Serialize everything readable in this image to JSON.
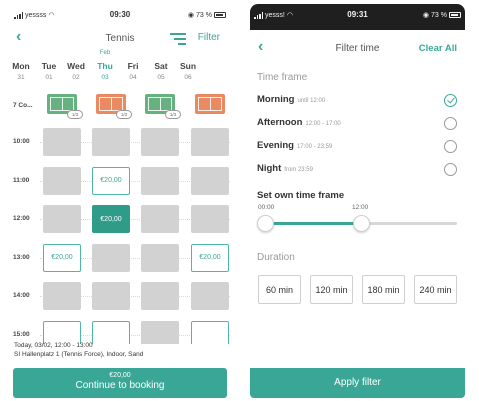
{
  "left": {
    "status": {
      "carrier": "yessss",
      "time": "09:30",
      "battery": "73 %"
    },
    "header": {
      "back_glyph": "‹",
      "title": "Tennis",
      "filter_icon": "filter-lines-icon",
      "filter_label": "Filter"
    },
    "month_label": "Feb",
    "days": [
      {
        "name": "Mon",
        "date": "31"
      },
      {
        "name": "Tue",
        "date": "01"
      },
      {
        "name": "Wed",
        "date": "02"
      },
      {
        "name": "Thu",
        "date": "03"
      },
      {
        "name": "Fri",
        "date": "04"
      },
      {
        "name": "Sat",
        "date": "05"
      },
      {
        "name": "Sun",
        "date": "06"
      }
    ],
    "court_row_label": "7 Co...",
    "courts": [
      {
        "color": "green",
        "badge": "1/3"
      },
      {
        "color": "orange",
        "badge": "1/3"
      },
      {
        "color": "green",
        "badge": "1/3"
      },
      {
        "color": "orange",
        "badge": ""
      }
    ],
    "times": [
      "10:00",
      "11:00",
      "12:00",
      "13:00",
      "14:00",
      "15:00"
    ],
    "slots": [
      [
        {
          "state": "unavailable",
          "price": ""
        },
        {
          "state": "unavailable",
          "price": ""
        },
        {
          "state": "unavailable",
          "price": ""
        },
        {
          "state": "unavailable",
          "price": ""
        }
      ],
      [
        {
          "state": "unavailable",
          "price": ""
        },
        {
          "state": "available",
          "price": "€20,00"
        },
        {
          "state": "unavailable",
          "price": ""
        },
        {
          "state": "unavailable",
          "price": ""
        }
      ],
      [
        {
          "state": "unavailable",
          "price": ""
        },
        {
          "state": "selected",
          "price": "€20,00"
        },
        {
          "state": "unavailable",
          "price": ""
        },
        {
          "state": "unavailable",
          "price": ""
        }
      ],
      [
        {
          "state": "available",
          "price": "€20,00"
        },
        {
          "state": "unavailable",
          "price": ""
        },
        {
          "state": "unavailable",
          "price": ""
        },
        {
          "state": "available",
          "price": "€20,00"
        }
      ],
      [
        {
          "state": "unavailable",
          "price": ""
        },
        {
          "state": "unavailable",
          "price": ""
        },
        {
          "state": "unavailable",
          "price": ""
        },
        {
          "state": "unavailable",
          "price": ""
        }
      ],
      [
        {
          "state": "available",
          "price": ""
        },
        {
          "state": "available",
          "price": ""
        },
        {
          "state": "unavailable",
          "price": ""
        },
        {
          "state": "available",
          "price": ""
        }
      ]
    ],
    "summary": {
      "line1": "Today, 03/02, 12:00 - 13:00",
      "line2": "SI Hallenplatz 1 (Tennis Force), Indoor, Sand"
    },
    "cta": {
      "price": "€20,00",
      "label": "Continue to booking"
    }
  },
  "right": {
    "status": {
      "carrier": "yesss!",
      "time": "09:31",
      "battery": "73 %"
    },
    "header": {
      "back_glyph": "‹",
      "title": "Filter time",
      "clear": "Clear All"
    },
    "timeframe_heading": "Time frame",
    "timeframes": [
      {
        "label": "Morning",
        "sub": "until 12:00",
        "selected": true
      },
      {
        "label": "Afternoon",
        "sub": "12:00 - 17:00",
        "selected": false
      },
      {
        "label": "Evening",
        "sub": "17:00 - 23:59",
        "selected": false
      },
      {
        "label": "Night",
        "sub": "from 23:59",
        "selected": false
      }
    ],
    "own_timeframe": {
      "label": "Set own time frame",
      "start": "00:00",
      "end": "12:00",
      "range_fraction": [
        0,
        0.5
      ]
    },
    "duration_heading": "Duration",
    "durations": [
      "60 min",
      "120 min",
      "180 min",
      "240 min"
    ],
    "apply": "Apply filter"
  },
  "colors": {
    "accent": "#3aa796",
    "unavailable": "#d2d2d2",
    "court_green": "#67b07f",
    "court_orange": "#e98a63"
  }
}
